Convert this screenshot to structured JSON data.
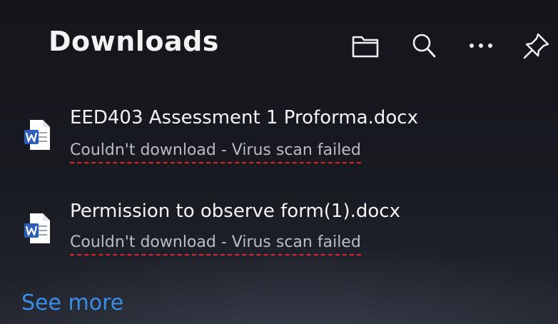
{
  "header": {
    "title": "Downloads",
    "icons": [
      "folder-icon",
      "search-icon",
      "more-icon",
      "pin-icon"
    ]
  },
  "downloads": [
    {
      "file_name": "EED403 Assessment 1 Proforma.docx",
      "status": "Couldn't download - Virus scan failed",
      "icon": "word-document-icon"
    },
    {
      "file_name": "Permission to observe form(1).docx",
      "status": "Couldn't download - Virus scan failed",
      "icon": "word-document-icon"
    }
  ],
  "footer": {
    "see_more_label": "See more"
  },
  "colors": {
    "background": "#15161c",
    "link": "#3a8ee6",
    "status_text": "#b9bdc6",
    "annotation_underline": "#e0242a",
    "word_blue": "#2b5cb8"
  }
}
